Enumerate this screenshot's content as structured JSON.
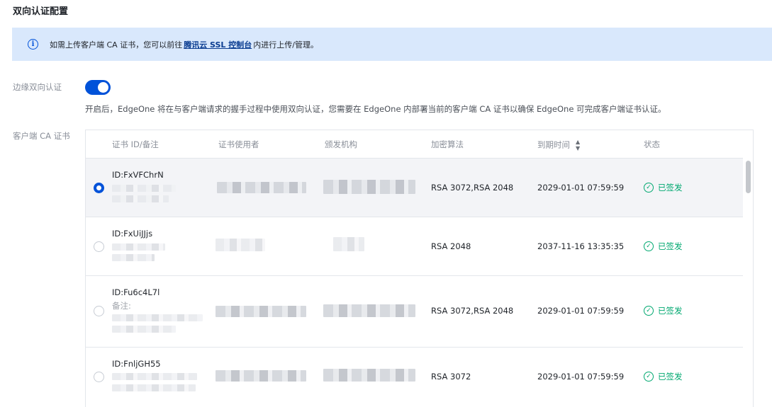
{
  "section": {
    "title": "双向认证配置"
  },
  "banner": {
    "text_before": "如需上传客户端 CA 证书，您可以前往",
    "link": "腾讯云 SSL 控制台",
    "text_after": "内进行上传/管理。",
    "icon": "info-icon"
  },
  "mtls": {
    "label": "边缘双向认证",
    "enabled": true,
    "description": "开启后，EdgeOne 将在与客户端请求的握手过程中使用双向认证，您需要在 EdgeOne 内部署当前的客户端 CA 证书以确保 EdgeOne 可完成客户端证书认证。"
  },
  "certs": {
    "label": "客户端 CA 证书",
    "columns": [
      "证书 ID/备注",
      "证书使用者",
      "颁发机构",
      "加密算法",
      "到期时间",
      "状态"
    ],
    "rows": [
      {
        "id": "ID:FxVFChrN",
        "note": "",
        "algorithm": "RSA 3072,RSA 2048",
        "expires": "2029-01-01 07:59:59",
        "status": "已签发",
        "selected": true
      },
      {
        "id": "ID:FxUiJJjs",
        "note": "",
        "algorithm": "RSA 2048",
        "expires": "2037-11-16 13:35:35",
        "status": "已签发",
        "selected": false
      },
      {
        "id": "ID:Fu6c4L7l",
        "note": "备注:",
        "algorithm": "RSA 3072,RSA 2048",
        "expires": "2029-01-01 07:59:59",
        "status": "已签发",
        "selected": false
      },
      {
        "id": "ID:FnljGH55",
        "note": "",
        "algorithm": "RSA 3072",
        "expires": "2029-01-01 07:59:59",
        "status": "已签发",
        "selected": false
      }
    ]
  },
  "colors": {
    "accent": "#0052d9",
    "success": "#00a870",
    "banner_bg": "#d9e8fc"
  }
}
